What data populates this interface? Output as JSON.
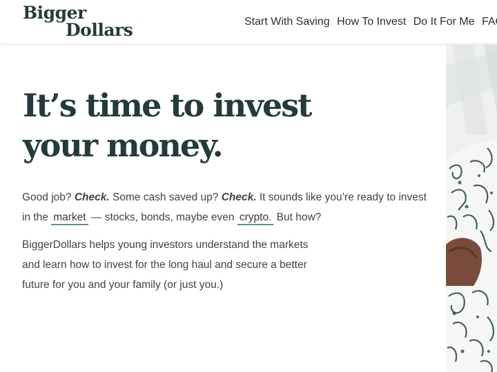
{
  "header": {
    "logo": {
      "line1": "Bigger",
      "line2": "Dollars"
    },
    "nav": [
      {
        "label": "Start With Saving"
      },
      {
        "label": "How To Invest"
      },
      {
        "label": "Do It For Me"
      },
      {
        "label": "FAQ"
      }
    ]
  },
  "hero": {
    "title_line1": "It’s time to invest",
    "title_line2": "your money.",
    "paragraph1": {
      "t1": "Good job? ",
      "e1": "Check.",
      "t2": " Some cash saved up? ",
      "e2": "Check.",
      "t3": " It sounds like you’re ready to invest in the ",
      "link1": "market",
      "t4": " — stocks, bonds, maybe even ",
      "link2": "crypto.",
      "t5": " But how?"
    },
    "paragraph2": "BiggerDollars helps young investors understand the markets and learn how to invest for the long haul and secure a better future for you and your family (or just you.)"
  },
  "photo": {
    "icon": "person-in-floral-shirt-photo"
  },
  "colors": {
    "brand": "#243b3b",
    "link_underline": "#5f8f8b",
    "text": "#3b4547"
  }
}
